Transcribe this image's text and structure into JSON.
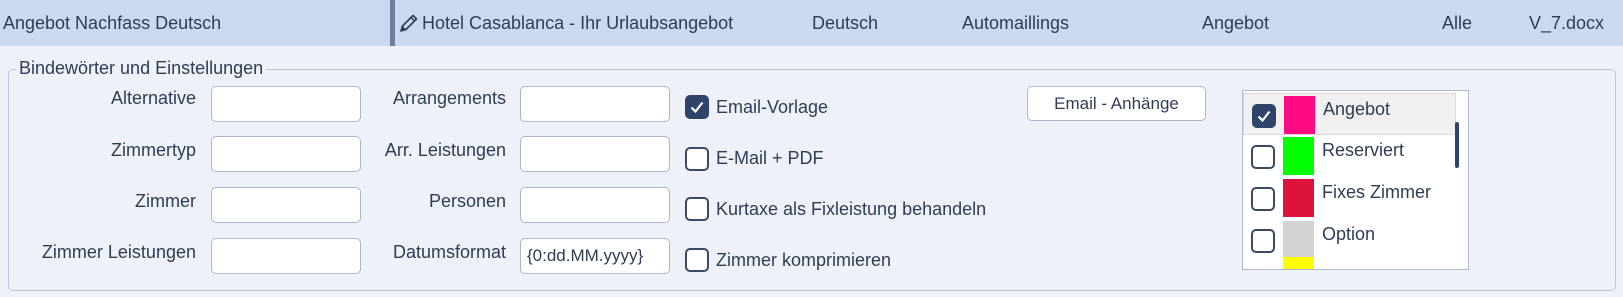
{
  "header": {
    "template_name": "Angebot Nachfass Deutsch",
    "subject": "Hotel Casablanca - Ihr Urlaubsangebot",
    "language": "Deutsch",
    "category": "Automaillings",
    "type": "Angebot",
    "scope": "Alle",
    "file": "V_7.docx"
  },
  "group": {
    "title": "Bindewörter und Einstellungen"
  },
  "fields_left": [
    {
      "label": "Alternative",
      "value": ""
    },
    {
      "label": "Zimmertyp",
      "value": ""
    },
    {
      "label": "Zimmer",
      "value": ""
    },
    {
      "label": "Zimmer Leistungen",
      "value": ""
    }
  ],
  "fields_mid": [
    {
      "label": "Arrangements",
      "value": ""
    },
    {
      "label": "Arr. Leistungen",
      "value": ""
    },
    {
      "label": "Personen",
      "value": ""
    },
    {
      "label": "Datumsformat",
      "value": "{0:dd.MM.yyyy}"
    }
  ],
  "options": [
    {
      "label": "Email-Vorlage",
      "checked": true
    },
    {
      "label": "E-Mail + PDF",
      "checked": false
    },
    {
      "label": "Kurtaxe als Fixleistung behandeln",
      "checked": false
    },
    {
      "label": "Zimmer komprimieren",
      "checked": false
    }
  ],
  "attachments_button": "Email - Anhänge",
  "status_list": [
    {
      "name": "Angebot",
      "color": "#ff0a84",
      "checked": true,
      "selected": true
    },
    {
      "name": "Reserviert",
      "color": "#00ff00",
      "checked": false,
      "selected": false
    },
    {
      "name": "Fixes Zimmer",
      "color": "#dc143c",
      "checked": false,
      "selected": false
    },
    {
      "name": "Option",
      "color": "#d3d3d3",
      "checked": false,
      "selected": false
    },
    {
      "name": "",
      "color": "#ffff00",
      "checked": false,
      "selected": false
    }
  ]
}
